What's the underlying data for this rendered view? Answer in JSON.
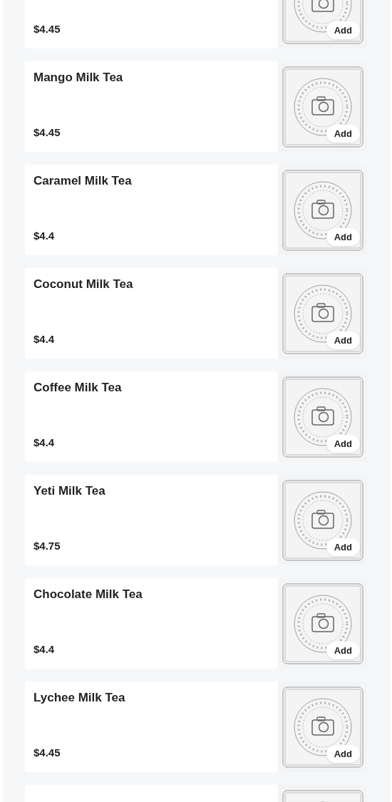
{
  "items": [
    {
      "price": "$4.45",
      "add_label": "Add",
      "image": {
        "kind": "picture"
      }
    },
    {
      "name": "Mango Milk Tea",
      "price": "$4.45",
      "add_label": "Add",
      "image": {
        "kind": "picture"
      }
    },
    {
      "name": "Caramel Milk Tea",
      "price": "$4.4",
      "add_label": "Add",
      "image": {
        "kind": "picture"
      }
    },
    {
      "name": "Coconut Milk Tea",
      "price": "$4.4",
      "add_label": "Add",
      "image": {
        "kind": "picture"
      }
    },
    {
      "name": "Coffee Milk Tea",
      "price": "$4.4",
      "add_label": "Add",
      "image": {
        "kind": "picture"
      }
    },
    {
      "name": "Yeti Milk Tea",
      "price": "$4.75",
      "add_label": "Add",
      "image": {
        "kind": "picture"
      }
    },
    {
      "name": "Chocolate Milk Tea",
      "price": "$4.4",
      "add_label": "Add",
      "image": {
        "kind": "picture"
      }
    },
    {
      "name": "Lychee Milk Tea",
      "price": "$4.45",
      "add_label": "Add",
      "image": {
        "kind": "picture"
      }
    },
    {
      "image": {
        "kind": "picture"
      }
    }
  ]
}
